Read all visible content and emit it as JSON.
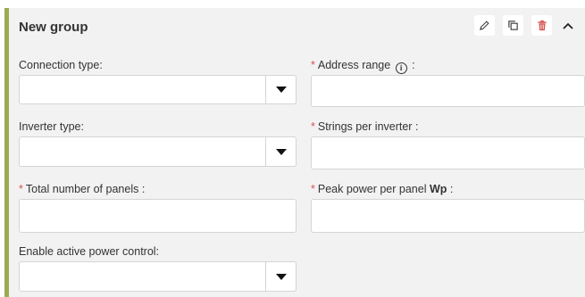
{
  "group": {
    "title": "New group",
    "actions": [
      {
        "name": "edit",
        "icon": "pencil-icon"
      },
      {
        "name": "duplicate",
        "icon": "copy-icon"
      },
      {
        "name": "delete",
        "icon": "trash-icon",
        "color": "#d9534f"
      }
    ],
    "collapse_icon": "chevron-up-icon"
  },
  "fields": {
    "connection_type": {
      "label": "Connection type:",
      "value": ""
    },
    "address_range": {
      "label": "Address range",
      "suffix": " :",
      "required_mark": "*",
      "info_glyph": "i",
      "value": ""
    },
    "inverter_type": {
      "label": "Inverter type:",
      "value": ""
    },
    "strings_per_inverter": {
      "label": "Strings per inverter :",
      "required_mark": "*",
      "value": ""
    },
    "total_panels": {
      "label": "Total number of panels :",
      "required_mark": "*",
      "value": ""
    },
    "peak_power": {
      "label": "Peak power per panel ",
      "unit": "Wp",
      "suffix": " :",
      "required_mark": "*",
      "value": ""
    },
    "active_power_control": {
      "label": "Enable active power control:",
      "value": ""
    }
  },
  "colors": {
    "accent_border": "#9bab4e",
    "required": "#d9534f",
    "panel_bg": "#f2f2f2"
  }
}
